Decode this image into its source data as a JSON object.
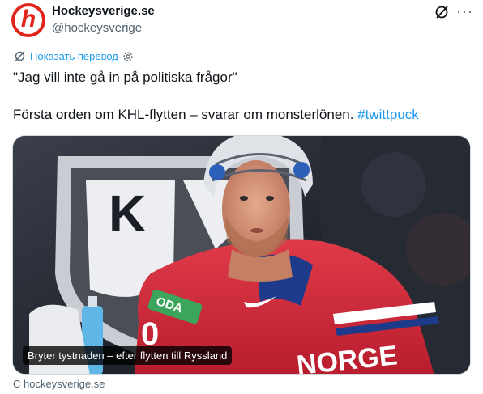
{
  "account": {
    "name": "Hockeysverige.se",
    "handle": "@hockeysverige",
    "avatar_letter": "h",
    "avatar_color": "#e1251b"
  },
  "actions": {
    "grok_icon": "grok-icon",
    "more_icon": "more-icon",
    "more_glyph": "···"
  },
  "translate": {
    "label": "Показать перевод"
  },
  "tweet": {
    "line1": "\"Jag vill inte gå in på politiska frågor\"",
    "line2": "Första orden om KHL-flytten – svarar om monsterlönen.",
    "hashtag": "#twittpuck"
  },
  "card": {
    "caption": "Bryter tystnaden – efter flytten till Ryssland",
    "source": "С hockeysverige.se",
    "logo_letter": "K",
    "jersey_text": "NORGE",
    "number_text": "0",
    "sponsor_text": "ODA"
  },
  "colors": {
    "link": "#1d9bf0",
    "secondary": "#536471",
    "jersey_red": "#d7263d"
  }
}
